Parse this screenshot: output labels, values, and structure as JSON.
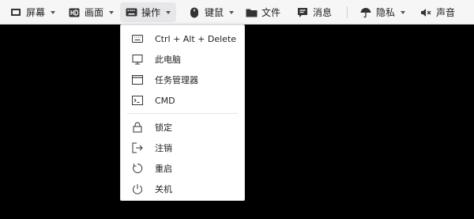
{
  "toolbar": {
    "items": [
      {
        "label": "屏幕",
        "icon": "monitor-icon"
      },
      {
        "label": "画面",
        "icon": "hd-icon"
      },
      {
        "label": "操作",
        "icon": "keyboard-icon"
      },
      {
        "label": "键鼠",
        "icon": "mouse-icon"
      },
      {
        "label": "文件",
        "icon": "folder-icon"
      },
      {
        "label": "消息",
        "icon": "message-icon"
      },
      {
        "label": "隐私",
        "icon": "umbrella-icon"
      },
      {
        "label": "声音",
        "icon": "speaker-muted-icon"
      }
    ],
    "active_item": "操作"
  },
  "operations_menu": {
    "items": [
      {
        "label": "Ctrl + Alt + Delete",
        "icon": "keyboard-icon"
      },
      {
        "label": "此电脑",
        "icon": "computer-icon"
      },
      {
        "label": "任务管理器",
        "icon": "window-icon"
      },
      {
        "label": "CMD",
        "icon": "terminal-icon"
      },
      {
        "label": "锁定",
        "icon": "lock-icon"
      },
      {
        "label": "注销",
        "icon": "logout-icon"
      },
      {
        "label": "重启",
        "icon": "restart-icon"
      },
      {
        "label": "关机",
        "icon": "power-icon"
      }
    ]
  },
  "colors": {
    "toolbar_bg": "#f6f6f7",
    "active_bg": "#e7e7ea",
    "menu_bg": "#ffffff",
    "desktop_bg": "#000000",
    "text": "#222222",
    "icon": "#333333"
  }
}
